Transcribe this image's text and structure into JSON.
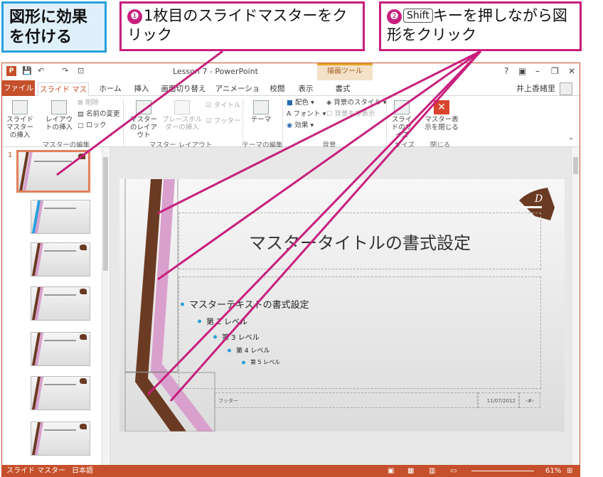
{
  "callouts": {
    "tag": "図形に効果を付ける",
    "step1": {
      "num": "❶",
      "text": "1枚目のスライドマスターをクリック"
    },
    "step2": {
      "num": "❷",
      "key": "Shift",
      "text": "キーを押しながら図形をクリック"
    }
  },
  "titlebar": {
    "title": "Lesson 7 - PowerPoint",
    "context_tab": "描画ツール",
    "controls": [
      "?",
      "▣",
      "–",
      "❐",
      "✕"
    ]
  },
  "tabs": [
    "ファイル",
    "スライド マスター",
    "ホーム",
    "挿入",
    "画面切り替え",
    "アニメーション",
    "校閲",
    "表示",
    "書式"
  ],
  "user": "井上香緒里",
  "ribbon": {
    "insert_master": "スライド マスターの挿入",
    "insert_layout": "レイアウトの挿入",
    "delete": "削除",
    "rename": "名前の変更",
    "lock": "ロック",
    "master_layout": "マスターのレイアウト",
    "insert_placeholder": "プレースホルダーの挿入",
    "title_check": "タイトル",
    "footer_check": "フッター",
    "theme": "テーマ",
    "colors": "配色",
    "fonts": "フォント",
    "effects": "効果",
    "bg_styles": "背景のスタイル",
    "hide_bg": "背景を非表示",
    "slide_size": "スライドのサイズ",
    "close_master": "マスター表示を閉じる",
    "groups": [
      "マスターの編集",
      "マスター レイアウト",
      "テーマの編集",
      "背景",
      "サイズ",
      "閉じる"
    ]
  },
  "thumbs": {
    "first_num": "1",
    "count": 7
  },
  "slide": {
    "title": "マスタータイトルの書式設定",
    "levels": [
      "マスターテキストの書式設定",
      "第 2 レベル",
      "第 3 レベル",
      "第 4 レベル",
      "第 5 レベル"
    ],
    "footer": "フッター",
    "date": "11/07/2012",
    "page": "‹#›"
  },
  "statusbar": {
    "view": "スライド マスター",
    "lang": "日本語",
    "zoom": "61%"
  },
  "colors": {
    "accent": "#c5502b",
    "callout": "#c81f7e",
    "tag_border": "#2aa0dc",
    "shape_brown": "#6b3a22",
    "shape_pink": "#d9a0cd"
  }
}
